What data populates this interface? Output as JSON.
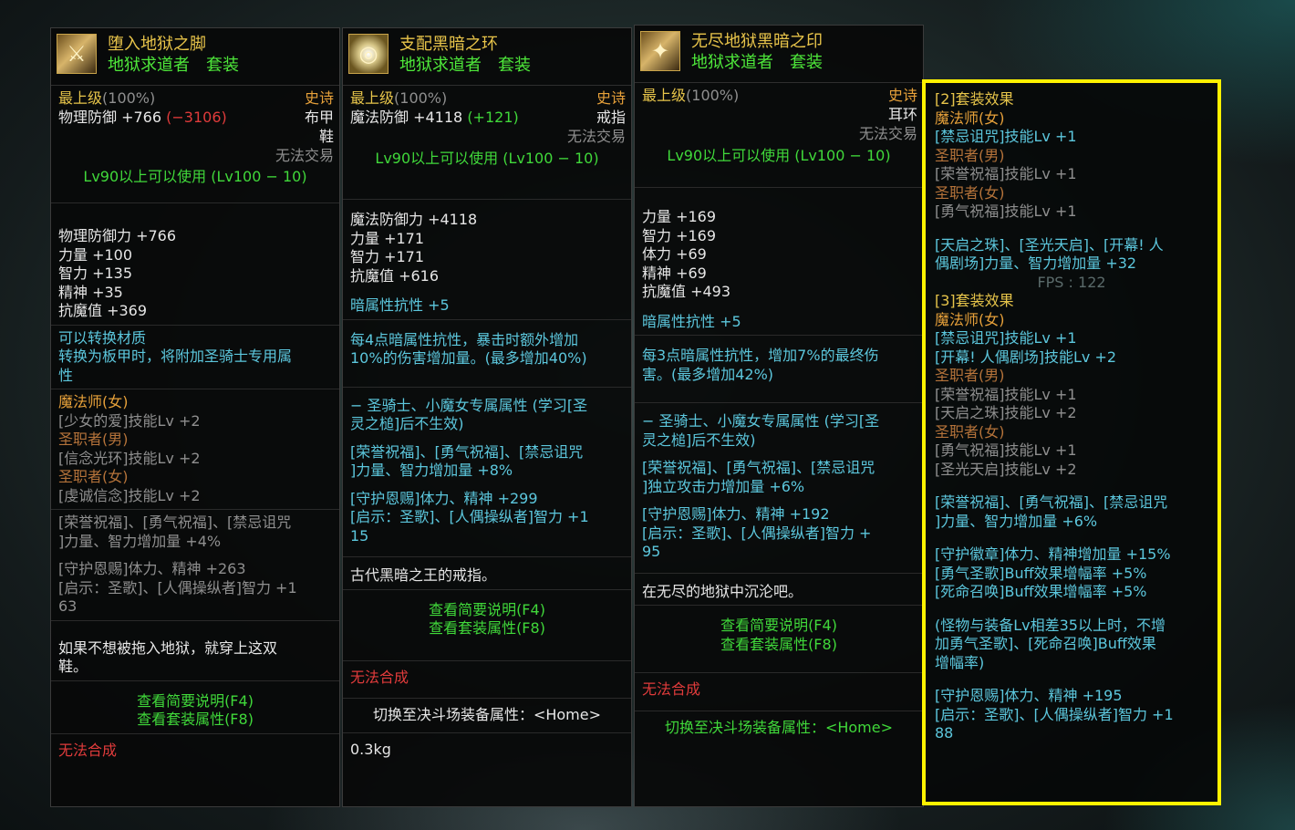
{
  "panel1": {
    "icon": "boots-icon",
    "title": "堕入地狱之脚",
    "subtitle": "地狱求道者　套装",
    "grade": "最上级",
    "grade_pct": "(100%)",
    "rarity": "史诗",
    "type1": "布甲",
    "type2": "鞋",
    "trade": "无法交易",
    "def_line": "物理防御 +766",
    "def_diff": "(−3106)",
    "level_req": "Lv90以上可以使用 (Lv100 − 10)",
    "stats": [
      "物理防御力 +766",
      "力量 +100",
      "智力 +135",
      "精神 +35",
      "抗魔值 +369"
    ],
    "convert": [
      "可以转换材质",
      "转换为板甲时，将附加圣骑士专用属",
      "性"
    ],
    "job1": "魔法师(女)",
    "skill1": "[少女的爱]技能Lv +2",
    "job2": "圣职者(男)",
    "skill2": "[信念光环]技能Lv +2",
    "job3": "圣职者(女)",
    "skill3": "[虔诚信念]技能Lv +2",
    "bonus1": [
      "[荣誉祝福]、[勇气祝福]、[禁忌诅咒",
      "]力量、智力增加量 +4%"
    ],
    "bonus2": [
      "[守护恩赐]体力、精神 +263",
      "[启示：圣歌]、[人偶操纵者]智力 +1",
      "63"
    ],
    "flavor": [
      "如果不想被拖入地狱，就穿上这双",
      "鞋。"
    ],
    "link1": "查看简要说明(F4)",
    "link2": "查看套装属性(F8)",
    "nocraft": "无法合成"
  },
  "panel2": {
    "icon": "ring-icon",
    "title": "支配黑暗之环",
    "subtitle": "地狱求道者　套装",
    "grade": "最上级",
    "grade_pct": "(100%)",
    "rarity": "史诗",
    "type1": "戒指",
    "trade": "无法交易",
    "def_line": "魔法防御 +4118",
    "def_diff": "(+121)",
    "level_req": "Lv90以上可以使用 (Lv100 − 10)",
    "stats": [
      "魔法防御力 +4118",
      "力量 +171",
      "智力 +171",
      "抗魔值 +616"
    ],
    "resist": "暗属性抗性 +5",
    "effect": [
      "每4点暗属性抗性，暴击时额外增加",
      "10%的伤害增加量。(最多增加40%)"
    ],
    "note": [
      "− 圣骑士、小魔女专属属性 (学习[圣",
      "灵之槌]后不生效)"
    ],
    "bonus1": [
      "[荣誉祝福]、[勇气祝福]、[禁忌诅咒",
      "]力量、智力增加量 +8%"
    ],
    "bonus2": [
      "[守护恩赐]体力、精神 +299",
      "[启示：圣歌]、[人偶操纵者]智力 +1",
      "15"
    ],
    "flavor": "古代黑暗之王的戒指。",
    "link1": "查看简要说明(F4)",
    "link2": "查看套装属性(F8)",
    "nocraft": "无法合成",
    "switch": "切换至决斗场装备属性：<Home>",
    "weight": "0.3kg"
  },
  "panel3": {
    "icon": "seal-icon",
    "title": "无尽地狱黑暗之印",
    "subtitle": "地狱求道者　套装",
    "grade": "最上级",
    "grade_pct": "(100%)",
    "rarity": "史诗",
    "type1": "耳环",
    "trade": "无法交易",
    "level_req": "Lv90以上可以使用 (Lv100 − 10)",
    "stats": [
      "力量 +169",
      "智力 +169",
      "体力 +69",
      "精神 +69",
      "抗魔值 +493"
    ],
    "resist": "暗属性抗性 +5",
    "effect": [
      "每3点暗属性抗性，增加7%的最终伤",
      "害。(最多增加42%)"
    ],
    "note": [
      "− 圣骑士、小魔女专属属性 (学习[圣",
      "灵之槌]后不生效)"
    ],
    "bonus1": [
      "[荣誉祝福]、[勇气祝福]、[禁忌诅咒",
      "]独立攻击力增加量 +6%"
    ],
    "bonus2": [
      "[守护恩赐]体力、精神 +192",
      "[启示：圣歌]、[人偶操纵者]智力 +",
      "95"
    ],
    "flavor": "在无尽的地狱中沉沦吧。",
    "link1": "查看简要说明(F4)",
    "link2": "查看套装属性(F8)",
    "nocraft": "无法合成",
    "switch": "切换至决斗场装备属性：<Home>"
  },
  "setbox": {
    "set2_title": "[2]套装效果",
    "s2_job1": "魔法师(女)",
    "s2_skill1": "[禁忌诅咒]技能Lv +1",
    "s2_job2": "圣职者(男)",
    "s2_skill2": "[荣誉祝福]技能Lv +1",
    "s2_job3": "圣职者(女)",
    "s2_skill3": "[勇气祝福]技能Lv +1",
    "s2_bonus": [
      "[天启之珠]、[圣光天启]、[开幕! 人",
      "偶剧场]力量、智力增加量 +32"
    ],
    "fps": "FPS : 122",
    "set3_title": "[3]套装效果",
    "s3_job1": "魔法师(女)",
    "s3_skill1a": "[禁忌诅咒]技能Lv +1",
    "s3_skill1b": "[开幕! 人偶剧场]技能Lv +2",
    "s3_job2": "圣职者(男)",
    "s3_skill2a": "[荣誉祝福]技能Lv +1",
    "s3_skill2b": "[天启之珠]技能Lv +2",
    "s3_job3": "圣职者(女)",
    "s3_skill3a": "[勇气祝福]技能Lv +1",
    "s3_skill3b": "[圣光天启]技能Lv +2",
    "s3_bonus1": [
      "[荣誉祝福]、[勇气祝福]、[禁忌诅咒",
      "]力量、智力增加量 +6%"
    ],
    "s3_bonus2": [
      "[守护徽章]体力、精神增加量 +15%",
      "[勇气圣歌]Buff效果增幅率 +5%",
      "[死命召唤]Buff效果增幅率 +5%"
    ],
    "s3_note": [
      "(怪物与装备Lv相差35以上时，不增",
      "加勇气圣歌]、[死命召唤]Buff效果",
      "增幅率)"
    ],
    "s3_bonus3": [
      "[守护恩赐]体力、精神 +195",
      "[启示：圣歌]、[人偶操纵者]智力 +1",
      "88"
    ]
  }
}
